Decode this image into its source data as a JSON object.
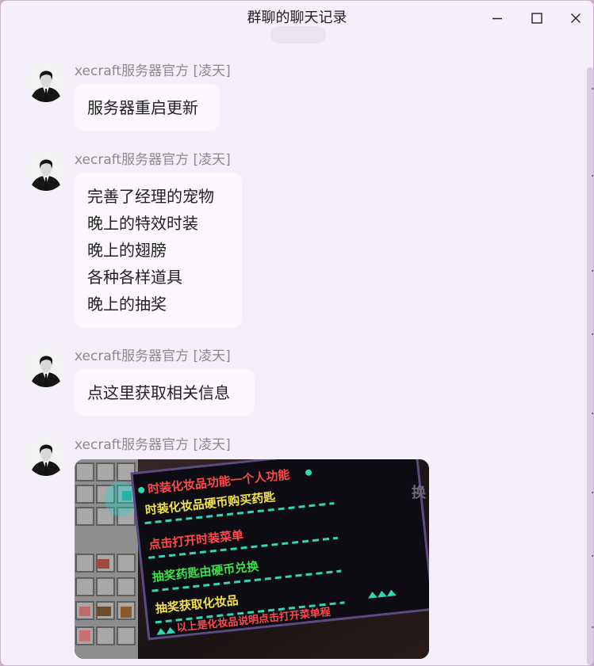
{
  "window": {
    "title": "群聊的聊天记录"
  },
  "messages": [
    {
      "sender": "xecraft服务器官方 [凌天]",
      "lines": [
        "服务器重启更新"
      ]
    },
    {
      "sender": "xecraft服务器官方 [凌天]",
      "lines": [
        "完善了经理的宠物",
        "晚上的特效时装",
        "晚上的翅膀",
        "各种各样道具",
        "晚上的抽奖"
      ]
    },
    {
      "sender": "xecraft服务器官方 [凌天]",
      "lines": [
        "点这里获取相关信息"
      ]
    },
    {
      "sender": "xecraft服务器官方 [凌天]",
      "image": {
        "sign_lines": [
          {
            "text": "时装化妆品功能一个人功能",
            "color": "#ff4a4a"
          },
          {
            "text": "时装化妆品硬币购买药匙",
            "color": "#f2e24a"
          },
          {
            "text": "点击打开时装菜单",
            "color": "#ff4a4a"
          },
          {
            "text": "抽奖药匙由硬币兑换",
            "color": "#3ce04a"
          },
          {
            "text": "抽奖获取化妆品",
            "color": "#f2e24a"
          },
          {
            "text": "以上是化妆品说明点击打开菜单程",
            "color": "#ff4a4a"
          }
        ],
        "side_text": "换"
      }
    }
  ]
}
